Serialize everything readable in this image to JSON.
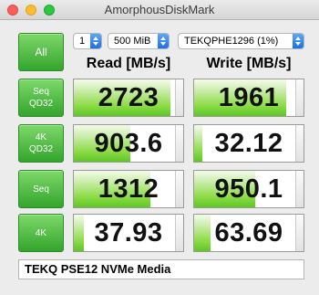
{
  "window": {
    "title": "AmorphousDiskMark"
  },
  "toolbar": {
    "all_label": "All",
    "count_value": "1",
    "size_value": "500 MiB",
    "drive_value": "TEKQPHE1296 (1%)"
  },
  "headers": {
    "read": "Read [MB/s]",
    "write": "Write [MB/s]"
  },
  "rows": [
    {
      "label_line1": "Seq",
      "label_line2": "QD32",
      "read": "2723",
      "write": "1961",
      "read_fill": 0.95,
      "write_fill": 0.9
    },
    {
      "label_line1": "4K",
      "label_line2": "QD32",
      "read": "903.6",
      "write": "32.12",
      "read_fill": 0.55,
      "write_fill": 0.08
    },
    {
      "label_line1": "Seq",
      "label_line2": "",
      "read": "1312",
      "write": "950.1",
      "read_fill": 0.75,
      "write_fill": 0.6
    },
    {
      "label_line1": "4K",
      "label_line2": "",
      "read": "37.93",
      "write": "63.69",
      "read_fill": 0.1,
      "write_fill": 0.16
    }
  ],
  "footer": {
    "device_name": "TEKQ PSE12 NVMe Media"
  },
  "colors": {
    "button_green": "#32a52c",
    "bar_green": "#5ec723",
    "select_blue": "#1c6fe3"
  }
}
